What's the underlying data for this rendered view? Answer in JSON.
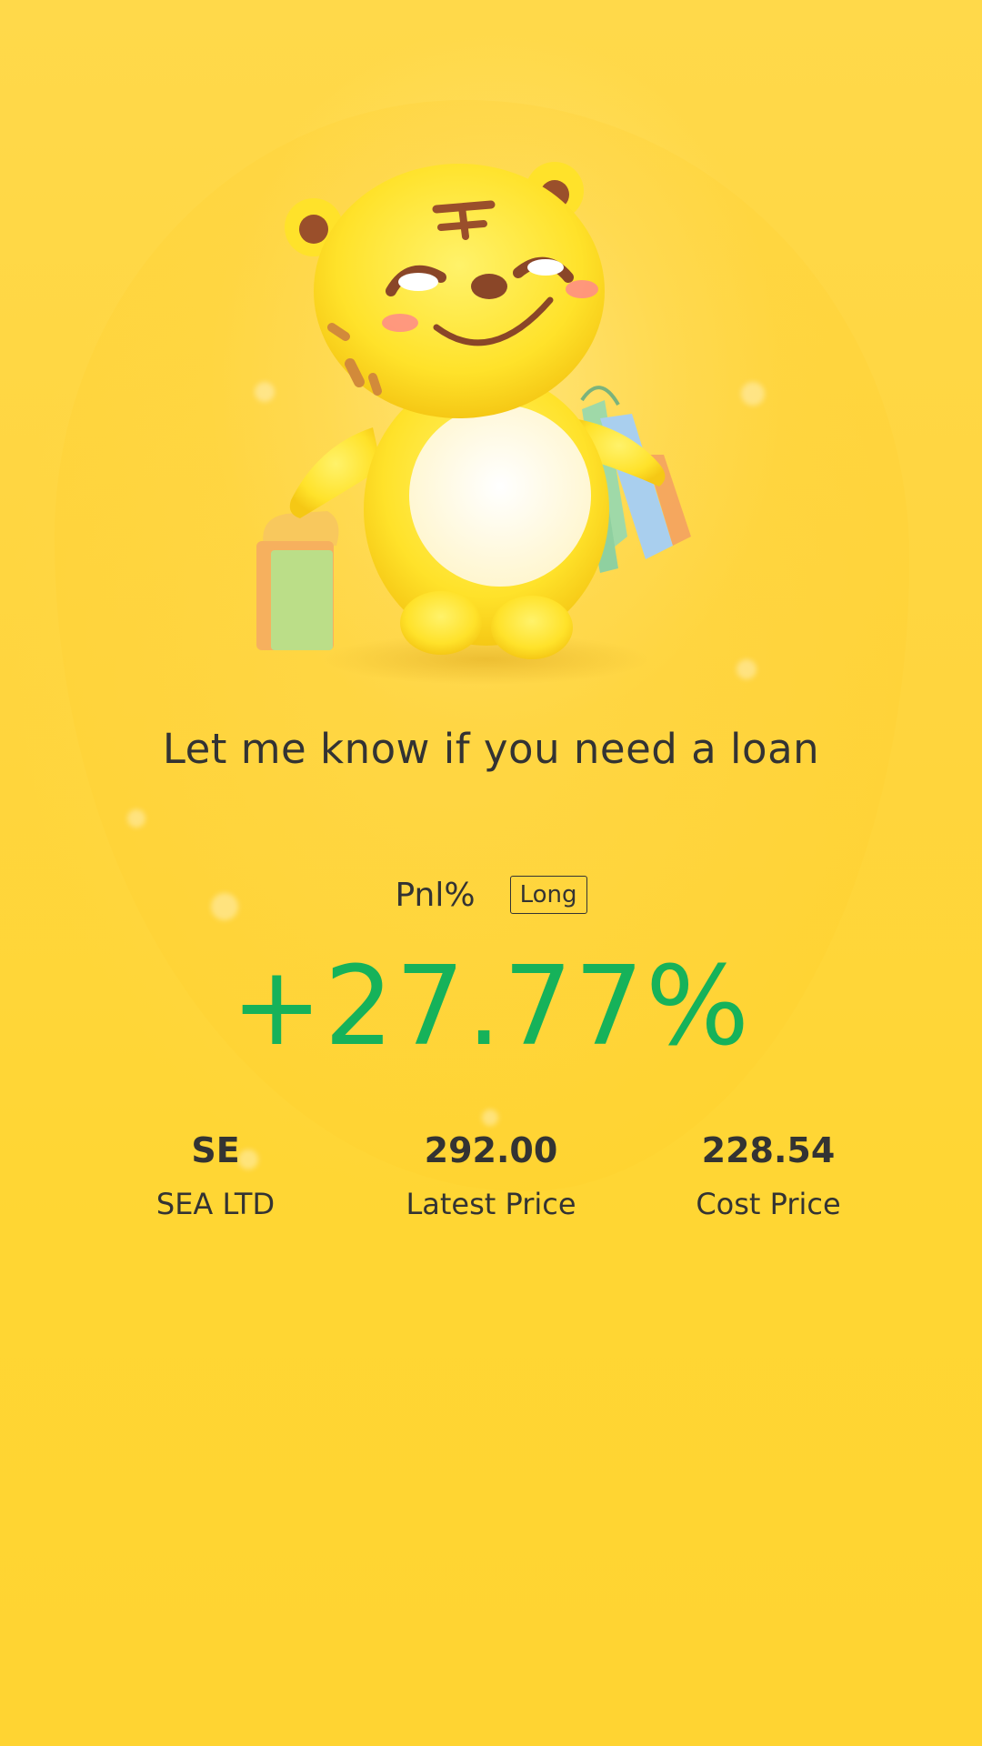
{
  "headline": "Let me know if you need a loan",
  "pnl": {
    "label": "Pnl%",
    "badge": "Long",
    "value": "+27.77%"
  },
  "stats": [
    {
      "value": "SE",
      "label": "SEA LTD"
    },
    {
      "value": "292.00",
      "label": "Latest Price"
    },
    {
      "value": "228.54",
      "label": "Cost Price"
    }
  ],
  "colors": {
    "background": "#ffd433",
    "text": "#333333",
    "gain": "#16b25a"
  },
  "illustration": "tiger-mascot-with-shopping-bags"
}
